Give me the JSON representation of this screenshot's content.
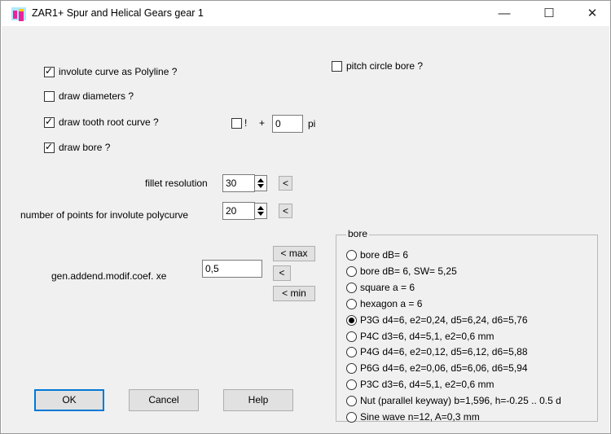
{
  "window": {
    "title": "ZAR1+  Spur and Helical Gears gear 1",
    "minimize": "—",
    "maximize": "☐",
    "close": "✕"
  },
  "options": {
    "involute_polyline": {
      "label": "involute curve as Polyline ?",
      "checked": true
    },
    "draw_diameters": {
      "label": "draw diameters ?",
      "checked": false
    },
    "draw_tooth_root": {
      "label": "draw tooth root curve ?",
      "checked": true
    },
    "draw_bore": {
      "label": "draw bore ?",
      "checked": true
    },
    "pitch_circle_bore": {
      "label": "pitch circle bore ?",
      "checked": false
    },
    "exclaim": {
      "label": "!",
      "checked": false
    },
    "plus_label": "+",
    "pi_value": "0",
    "pi_label": "pi"
  },
  "fillet": {
    "label": "fillet resolution",
    "value": "30",
    "reset": "<"
  },
  "involute_points": {
    "label": "number of points for involute polycurve",
    "value": "20",
    "reset": "<"
  },
  "xe": {
    "label": "gen.addend.modif.coef. xe",
    "value": "0,5",
    "max": "< max",
    "mid": "<",
    "min": "< min"
  },
  "bore": {
    "title": "bore",
    "selected": 4,
    "options": [
      "bore dB= 6",
      "bore dB= 6, SW= 5,25",
      "square a = 6",
      "hexagon a = 6",
      "P3G d4=6, e2=0,24, d5=6,24, d6=5,76",
      "P4C d3=6, d4=5,1, e2=0,6 mm",
      "P4G d4=6, e2=0,12, d5=6,12, d6=5,88",
      "P6G d4=6, e2=0,06, d5=6,06, d6=5,94",
      "P3C d3=6, d4=5,1, e2=0,6 mm",
      "Nut (parallel keyway) b=1,596, h=-0.25 .. 0.5 d",
      "Sine wave n=12, A=0,3 mm"
    ]
  },
  "buttons": {
    "ok": "OK",
    "cancel": "Cancel",
    "help": "Help"
  }
}
